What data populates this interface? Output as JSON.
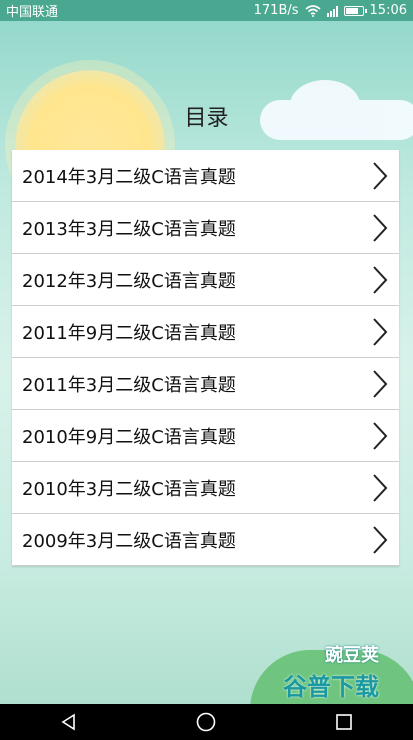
{
  "status_bar": {
    "carrier": "中国联通",
    "speed": "171B/s",
    "network": "4G",
    "time": "15:06"
  },
  "header": {
    "title": "目录"
  },
  "list": {
    "items": [
      {
        "label": "2014年3月二级C语言真题"
      },
      {
        "label": "2013年3月二级C语言真题"
      },
      {
        "label": "2012年3月二级C语言真题"
      },
      {
        "label": "2011年9月二级C语言真题"
      },
      {
        "label": "2011年3月二级C语言真题"
      },
      {
        "label": "2010年9月二级C语言真题"
      },
      {
        "label": "2010年3月二级C语言真题"
      },
      {
        "label": "2009年3月二级C语言真题"
      }
    ]
  },
  "watermark": {
    "line1": "豌豆荚",
    "line2": "谷普下载"
  },
  "nav": {
    "back_icon": "back-triangle-icon",
    "home_icon": "home-circle-icon",
    "recent_icon": "recent-square-icon"
  }
}
